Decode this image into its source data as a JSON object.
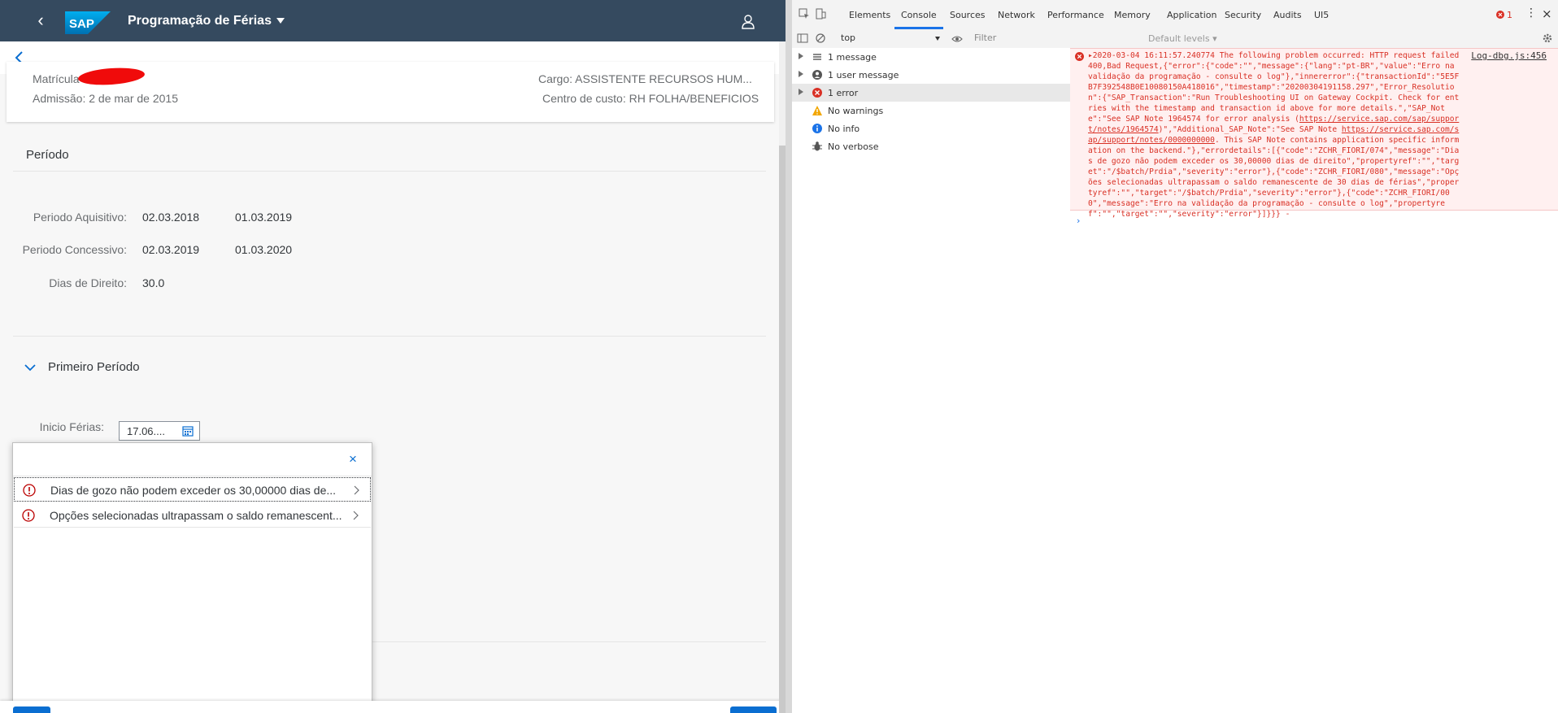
{
  "app": {
    "title": "Programação de Férias",
    "logo_text": "SAP",
    "header": {
      "matricula_label": "Matrícula",
      "admissao": "Admissão: 2 de mar de 2015",
      "cargo": "Cargo: ASSISTENTE RECURSOS HUM...",
      "centro_custo": "Centro de custo: RH FOLHA/BENEFICIOS"
    },
    "periodo": {
      "title": "Período",
      "rows": [
        {
          "label": "Periodo Aquisitivo:",
          "start": "02.03.2018",
          "end": "01.03.2019"
        },
        {
          "label": "Periodo Concessivo:",
          "start": "02.03.2019",
          "end": "01.03.2020"
        }
      ],
      "dias_label": "Dias de Direito:",
      "dias_value": "30.0"
    },
    "primeiro": {
      "title": "Primeiro Período",
      "inicio_label": "Inicio Férias:",
      "inicio_value": "17.06...."
    },
    "popover": {
      "messages": [
        {
          "text": "Dias de gozo não podem exceder os 30,00000 dias de..."
        },
        {
          "text": "Opções selecionadas ultrapassam o saldo remanescent..."
        }
      ]
    },
    "colors": {
      "shell": "#354a5f",
      "accent": "#0a6ed1",
      "error": "#bb0000"
    }
  },
  "devtools": {
    "tabs": [
      "Elements",
      "Console",
      "Sources",
      "Network",
      "Performance",
      "Memory",
      "Application",
      "Security",
      "Audits",
      "UI5"
    ],
    "active_tab": "Console",
    "error_count": "1",
    "toolbar": {
      "context": "top",
      "filter_placeholder": "Filter",
      "levels": "Default levels"
    },
    "sidebar": [
      {
        "label": "1 message",
        "icon": "list-icon"
      },
      {
        "label": "1 user message",
        "icon": "user-circle-icon"
      },
      {
        "label": "1 error",
        "icon": "error-icon"
      },
      {
        "label": "No warnings",
        "icon": "warning-icon"
      },
      {
        "label": "No info",
        "icon": "info-icon"
      },
      {
        "label": "No verbose",
        "icon": "bug-icon"
      }
    ],
    "console": {
      "source": "Log-dbg.js:456",
      "error_text_1": "▸2020-03-04 16:11:57.240774 The following problem occurred: HTTP request failed400,Bad Request,{\"error\":{\"code\":\"\",\"message\":{\"lang\":\"pt-BR\",\"value\":\"Erro na validação da programação - consulte o log\"},\"innererror\":{\"transactionId\":\"5E5FB7F392548B0E10080150A418016\",\"timestamp\":\"20200304191158.297\",\"Error_Resolution\":{\"SAP_Transaction\":\"Run Troubleshooting UI on Gateway Cockpit. Check for entries with the timestamp and transaction id above for more details.\",\"SAP_Note\":\"See SAP Note 1964574 for error analysis (",
      "link_1": "https://service.sap.com/sap/support/notes/1964574",
      "error_text_2": ")\",\"Additional_SAP_Note\":\"See SAP Note ",
      "link_2": "https://service.sap.com/sap/support/notes/0000000000",
      "error_text_3": ". This SAP Note contains application specific information on the backend.\"},\"errordetails\":[{\"code\":\"ZCHR_FIORI/074\",\"message\":\"Dias de gozo não podem exceder os 30,00000 dias de direito\",\"propertyref\":\"\",\"target\":\"/$batch/Prdia\",\"severity\":\"error\"},{\"code\":\"ZCHR_FIORI/080\",\"message\":\"Opções selecionadas ultrapassam o saldo remanescente de 30 dias de férias\",\"propertyref\":\"\",\"target\":\"/$batch/Prdia\",\"severity\":\"error\"},{\"code\":\"ZCHR_FIORI/000\",\"message\":\"Erro na validação da programação - consulte o log\",\"propertyref\":\"\",\"target\":\"\",\"severity\":\"error\"}]}}} -",
      "prompt": "›"
    }
  }
}
